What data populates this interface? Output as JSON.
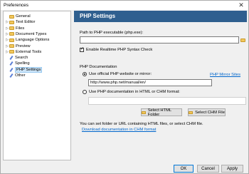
{
  "window": {
    "title": "Preferences",
    "close_glyph": "✕"
  },
  "tree": [
    {
      "label": "General",
      "icon": "folder-icon",
      "expander": "",
      "selected": false
    },
    {
      "label": "Text Editor",
      "icon": "folder-icon",
      "expander": "▷",
      "selected": false
    },
    {
      "label": "Files",
      "icon": "folder-icon",
      "expander": "▷",
      "selected": false
    },
    {
      "label": "Document Types",
      "icon": "folder-icon",
      "expander": "▷",
      "selected": false
    },
    {
      "label": "Language Options",
      "icon": "folder-icon",
      "expander": "▷",
      "selected": false
    },
    {
      "label": "Preview",
      "icon": "folder-icon",
      "expander": "▷",
      "selected": false
    },
    {
      "label": "External Tools",
      "icon": "folder-icon",
      "expander": "▷",
      "selected": false
    },
    {
      "label": "Search",
      "icon": "pencil-icon",
      "expander": "",
      "selected": false
    },
    {
      "label": "Spelling",
      "icon": "pencil-icon",
      "expander": "",
      "selected": false
    },
    {
      "label": "PHP Settings",
      "icon": "pencil-icon",
      "expander": "",
      "selected": true
    },
    {
      "label": "Other",
      "icon": "pencil-icon",
      "expander": "",
      "selected": false
    }
  ],
  "panel": {
    "header": "PHP Settings",
    "path_label": "Path to PHP executable (php.exe):",
    "path_value": "",
    "realtime_check_label": "Enable Realtime PHP Syntax Check",
    "realtime_checked": true,
    "check_glyph": "✓",
    "doc_group_label": "PHP Documentation",
    "radio_official_label": "Use official PHP website or mirror:",
    "radio_official_selected": true,
    "mirror_link": "PHP Mirror Sites",
    "url_value": "http://www.php.net/manual/en/",
    "radio_local_label": "Use PHP documentation in HTML or CHM format:",
    "radio_local_selected": false,
    "chm_value": "",
    "select_html_label": "Select HTML Folder",
    "select_chm_label": "Select CHM File",
    "note_line1": "You can set folder or URL containing HTML files, or select CHM file.",
    "download_link": "Download documentation in CHM format"
  },
  "footer": {
    "ok": "OK",
    "cancel": "Cancel",
    "apply": "Apply"
  }
}
